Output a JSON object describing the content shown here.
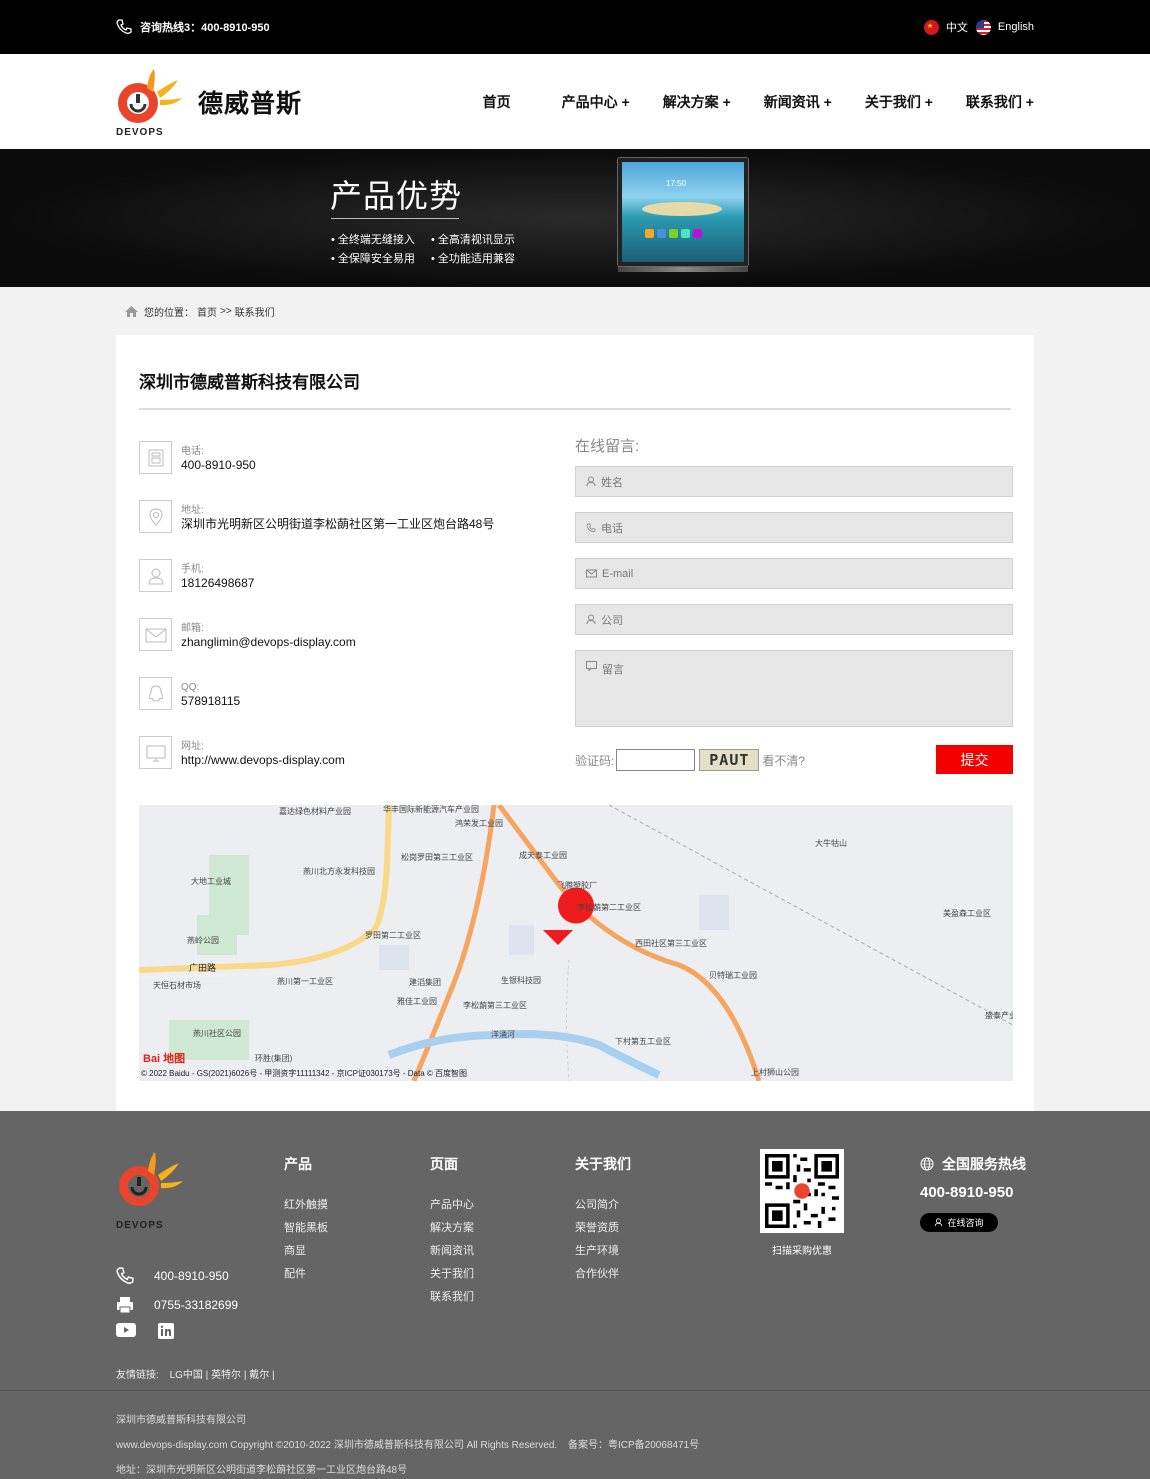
{
  "topbar": {
    "hotline": "咨询热线3：400-8910-950",
    "lang_cn": "中文",
    "lang_en": "English"
  },
  "header": {
    "logo_text": "德威普斯",
    "logo_sub": "DEVOPS",
    "nav": [
      "首页",
      "产品中心",
      "解决方案",
      "新闻资讯",
      "关于我们",
      "联系我们"
    ]
  },
  "banner": {
    "title": "产品优势",
    "features": [
      "全终端无缝接入",
      "全高清视讯显示",
      "全保障安全易用",
      "全功能适用兼容"
    ],
    "tv_time": "17:50"
  },
  "breadcrumb": {
    "prefix": "您的位置：",
    "home": "首页",
    "sep": ">>",
    "current": "联系我们"
  },
  "contact": {
    "company": "深圳市德威普斯科技有限公司",
    "items": [
      {
        "label": "电话:",
        "value": "400-8910-950",
        "icon": "phone-icon"
      },
      {
        "label": "地址:",
        "value": "深圳市光明新区公明街道李松蓢社区第一工业区炮台路48号",
        "icon": "location-icon"
      },
      {
        "label": "手机:",
        "value": "18126498687",
        "icon": "user-icon"
      },
      {
        "label": "邮箱:",
        "value": "zhanglimin@devops-display.com",
        "icon": "mail-icon"
      },
      {
        "label": "QQ:",
        "value": "578918115",
        "icon": "qq-icon"
      },
      {
        "label": "网址:",
        "value": "http://www.devops-display.com",
        "icon": "monitor-icon"
      }
    ]
  },
  "form": {
    "title": "在线留言:",
    "name_ph": "姓名",
    "phone_ph": "电话",
    "email_ph": "E-mail",
    "company_ph": "公司",
    "message_ph": "留言",
    "captcha_label": "验证码:",
    "captcha_text": "PAUT",
    "captcha_hint": "看不清?",
    "submit": "提交"
  },
  "map": {
    "labels": [
      "嘉达绿色材料产业园",
      "华丰国际新能源汽车产业园",
      "鸿荣发工业园",
      "松岗罗田第三工业区",
      "成天泰工业园",
      "大牛牯山",
      "燕川北方永发科技园",
      "大地工业城",
      "飞腾塑胶厂",
      "李松蓢第二工业区",
      "美盈森工业区",
      "罗田第二工业区",
      "燕岭公园",
      "西田社区第三工业区",
      "广田路",
      "贝特瑞工业园",
      "天恒石材市场",
      "燕川第一工业区",
      "建滔集团",
      "生银科技园",
      "雅佳工业园",
      "李松蓢第三工业区",
      "燕川社区公园",
      "洋涌河",
      "下村第五工业区",
      "环胜(集团)",
      "上村狮山公园",
      "盛泰产业"
    ],
    "baidu": "Bai 地图",
    "copyright": "© 2022 Baidu - GS(2021)6026号 - 甲测资字11111342 - 京ICP证030173号 - Data © 百度智图"
  },
  "footer": {
    "logo_sub": "DEVOPS",
    "phone": "400-8910-950",
    "fax": "0755-33182699",
    "col_products": {
      "title": "产品",
      "links": [
        "红外触摸",
        "智能黑板",
        "商显",
        "配件"
      ]
    },
    "col_pages": {
      "title": "页面",
      "links": [
        "产品中心",
        "解决方案",
        "新闻资讯",
        "关于我们",
        "联系我们"
      ]
    },
    "col_about": {
      "title": "关于我们",
      "links": [
        "公司简介",
        "荣誉资质",
        "生产环境",
        "合作伙伴"
      ]
    },
    "qr_caption": "扫描采购优惠",
    "hotline_title": "全国服务热线",
    "hotline_number": "400-8910-950",
    "consult_btn": "在线咨询",
    "links_label": "友情链接:",
    "links": [
      "LG中国",
      "英特尔",
      "戴尔"
    ],
    "company": "深圳市德威普斯科技有限公司",
    "copyright": "www.devops-display.com Copyright ©2010-2022 深圳市德威普斯科技有限公司 All Rights Reserved.",
    "icp": "备案号：粤ICP备20068471号",
    "address": "地址：深圳市光明新区公明街道李松蓢社区第一工业区炮台路48号"
  },
  "colors": {
    "accent": "#f40000",
    "topbar": "#000000",
    "footer": "#656565"
  }
}
